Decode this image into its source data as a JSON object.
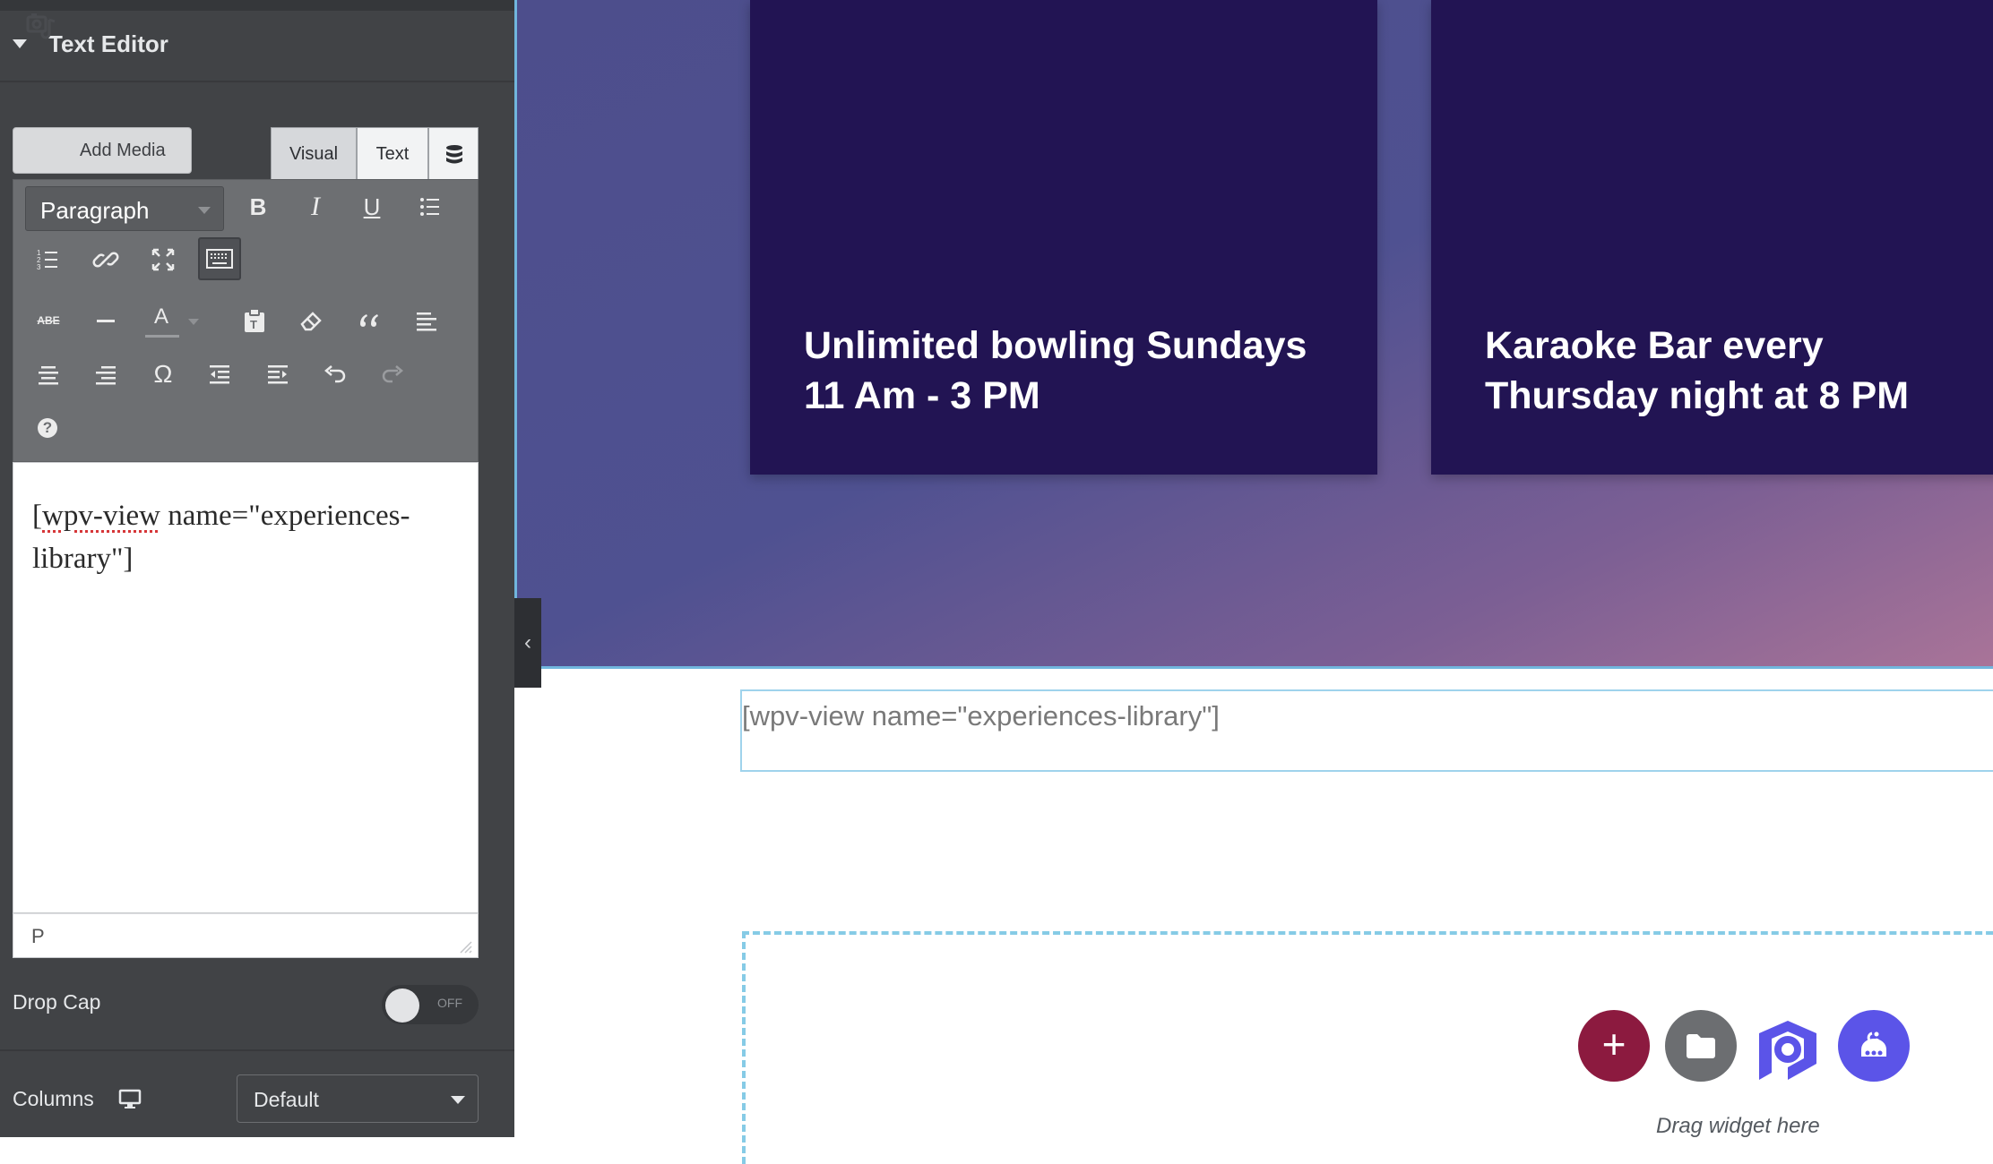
{
  "panel": {
    "section_title": "Text Editor",
    "add_media_label": "Add Media",
    "tabs": {
      "visual": "Visual",
      "text": "Text"
    },
    "format_select": "Paragraph",
    "toolbar_glyphs": {
      "bold": "B",
      "italic": "I",
      "underline": "U",
      "text_color": "A",
      "strikethrough": "ABE",
      "special_char": "Ω",
      "help": "?"
    },
    "editor_content_part1": "[",
    "editor_content_spell": "wpv-view",
    "editor_content_part2": " name=\"experiences-library\"]",
    "status_path": "P",
    "drop_cap_label": "Drop Cap",
    "drop_cap_state": "OFF",
    "columns_label": "Columns",
    "columns_value": "Default"
  },
  "canvas": {
    "card_1_text": "Unlimited bowling Sundays 11 Am - 3 PM",
    "card_2_text": "Karaoke Bar every Thursday night at 8 PM",
    "shortcode_text": "[wpv-view name=\"experiences-library\"]",
    "collapse_glyph": "‹",
    "add_glyph": "+",
    "drag_hint": "Drag widget here"
  },
  "colors": {
    "panel_bg": "#414346",
    "card_bg": "#221453",
    "accent_blue": "#71b6dd",
    "add_button": "#8c1a3f",
    "robot_button": "#5b54e8"
  },
  "icons": [
    "caret-down-icon",
    "add-media-icon",
    "database-icon",
    "bullet-list-icon",
    "numbered-list-icon",
    "link-icon",
    "fullscreen-icon",
    "keyboard-icon",
    "horizontal-rule-icon",
    "paste-icon",
    "eraser-icon",
    "blockquote-icon",
    "align-left-icon",
    "align-center-icon",
    "align-right-icon",
    "outdent-icon",
    "indent-icon",
    "undo-icon",
    "redo-icon",
    "help-icon",
    "desktop-icon",
    "folder-icon",
    "p-logo-icon",
    "robot-icon"
  ]
}
